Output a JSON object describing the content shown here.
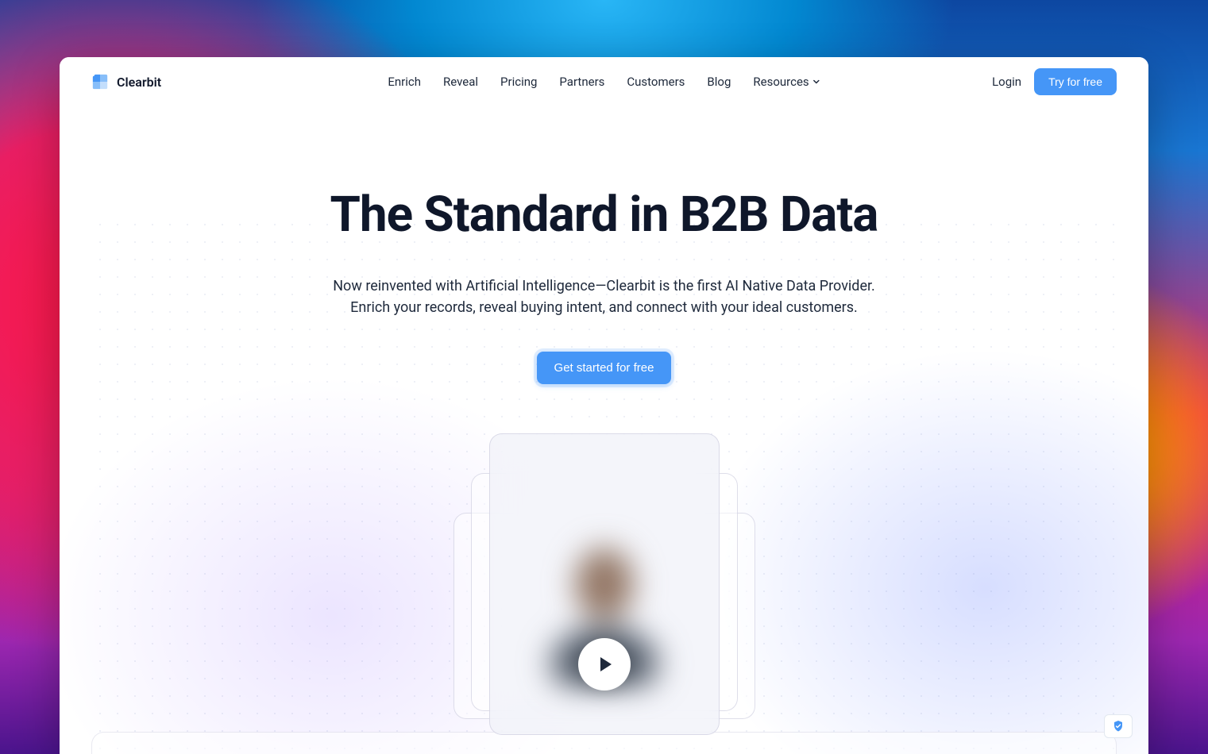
{
  "brand": {
    "name": "Clearbit"
  },
  "nav": {
    "links": [
      {
        "label": "Enrich"
      },
      {
        "label": "Reveal"
      },
      {
        "label": "Pricing"
      },
      {
        "label": "Partners"
      },
      {
        "label": "Customers"
      },
      {
        "label": "Blog"
      },
      {
        "label": "Resources",
        "has_dropdown": true
      }
    ],
    "login": "Login",
    "cta": "Try for free"
  },
  "hero": {
    "title": "The Standard in B2B Data",
    "subtitle_line1": "Now reinvented with Artificial Intelligence—Clearbit is the first AI Native Data Provider.",
    "subtitle_line2": "Enrich your records, reveal buying intent, and connect with your ideal customers.",
    "cta": "Get started for free"
  },
  "colors": {
    "primary": "#4596f7",
    "text_dark": "#0f172a"
  }
}
